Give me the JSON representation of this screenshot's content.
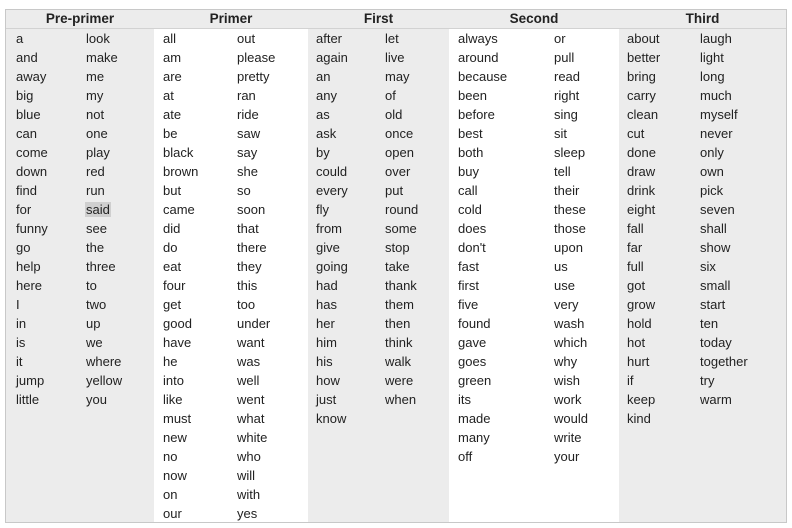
{
  "groups": [
    {
      "title": "Pre-primer",
      "bg": "#ececec",
      "cols": [
        [
          "a",
          "and",
          "away",
          "big",
          "blue",
          "can",
          "come",
          "down",
          "find",
          "for",
          "funny",
          "go",
          "help",
          "here",
          "I",
          "in",
          "is",
          "it",
          "jump",
          "little"
        ],
        [
          "look",
          "make",
          "me",
          "my",
          "not",
          "one",
          "play",
          "red",
          "run",
          "said",
          "see",
          "the",
          "three",
          "to",
          "two",
          "up",
          "we",
          "where",
          "yellow",
          "you"
        ]
      ]
    },
    {
      "title": "Primer",
      "bg": "#ffffff",
      "cols": [
        [
          "all",
          "am",
          "are",
          "at",
          "ate",
          "be",
          "black",
          "brown",
          "but",
          "came",
          "did",
          "do",
          "eat",
          "four",
          "get",
          "good",
          "have",
          "he",
          "into",
          "like",
          "must",
          "new",
          "no",
          "now",
          "on",
          "our"
        ],
        [
          "out",
          "please",
          "pretty",
          "ran",
          "ride",
          "saw",
          "say",
          "she",
          "so",
          "soon",
          "that",
          "there",
          "they",
          "this",
          "too",
          "under",
          "want",
          "was",
          "well",
          "went",
          "what",
          "white",
          "who",
          "will",
          "with",
          "yes"
        ]
      ]
    },
    {
      "title": "First",
      "bg": "#ececec",
      "cols": [
        [
          "after",
          "again",
          "an",
          "any",
          "as",
          "ask",
          "by",
          "could",
          "every",
          "fly",
          "from",
          "give",
          "going",
          "had",
          "has",
          "her",
          "him",
          "his",
          "how",
          "just",
          "know"
        ],
        [
          "let",
          "live",
          "may",
          "of",
          "old",
          "once",
          "open",
          "over",
          "put",
          "round",
          "some",
          "stop",
          "take",
          "thank",
          "them",
          "then",
          "think",
          "walk",
          "were",
          "when"
        ]
      ]
    },
    {
      "title": "Second",
      "bg": "#ffffff",
      "cols": [
        [
          "always",
          "around",
          "because",
          "been",
          "before",
          "best",
          "both",
          "buy",
          "call",
          "cold",
          "does",
          "don't",
          "fast",
          "first",
          "five",
          "found",
          "gave",
          "goes",
          "green",
          "its",
          "made",
          "many",
          "off"
        ],
        [
          "or",
          "pull",
          "read",
          "right",
          "sing",
          "sit",
          "sleep",
          "tell",
          "their",
          "these",
          "those",
          "upon",
          "us",
          "use",
          "very",
          "wash",
          "which",
          "why",
          "wish",
          "work",
          "would",
          "write",
          "your"
        ]
      ]
    },
    {
      "title": "Third",
      "bg": "#ececec",
      "cols": [
        [
          "about",
          "better",
          "bring",
          "carry",
          "clean",
          "cut",
          "done",
          "draw",
          "drink",
          "eight",
          "fall",
          "far",
          "full",
          "got",
          "grow",
          "hold",
          "hot",
          "hurt",
          "if",
          "keep",
          "kind"
        ],
        [
          "laugh",
          "light",
          "long",
          "much",
          "myself",
          "never",
          "only",
          "own",
          "pick",
          "seven",
          "shall",
          "show",
          "six",
          "small",
          "start",
          "ten",
          "today",
          "together",
          "try",
          "warm"
        ]
      ]
    }
  ],
  "highlighted_word": "said",
  "colors": {
    "gray": "#ececec",
    "white": "#ffffff",
    "highlight": "#cfcfcf",
    "border": "#c8c8c8"
  }
}
